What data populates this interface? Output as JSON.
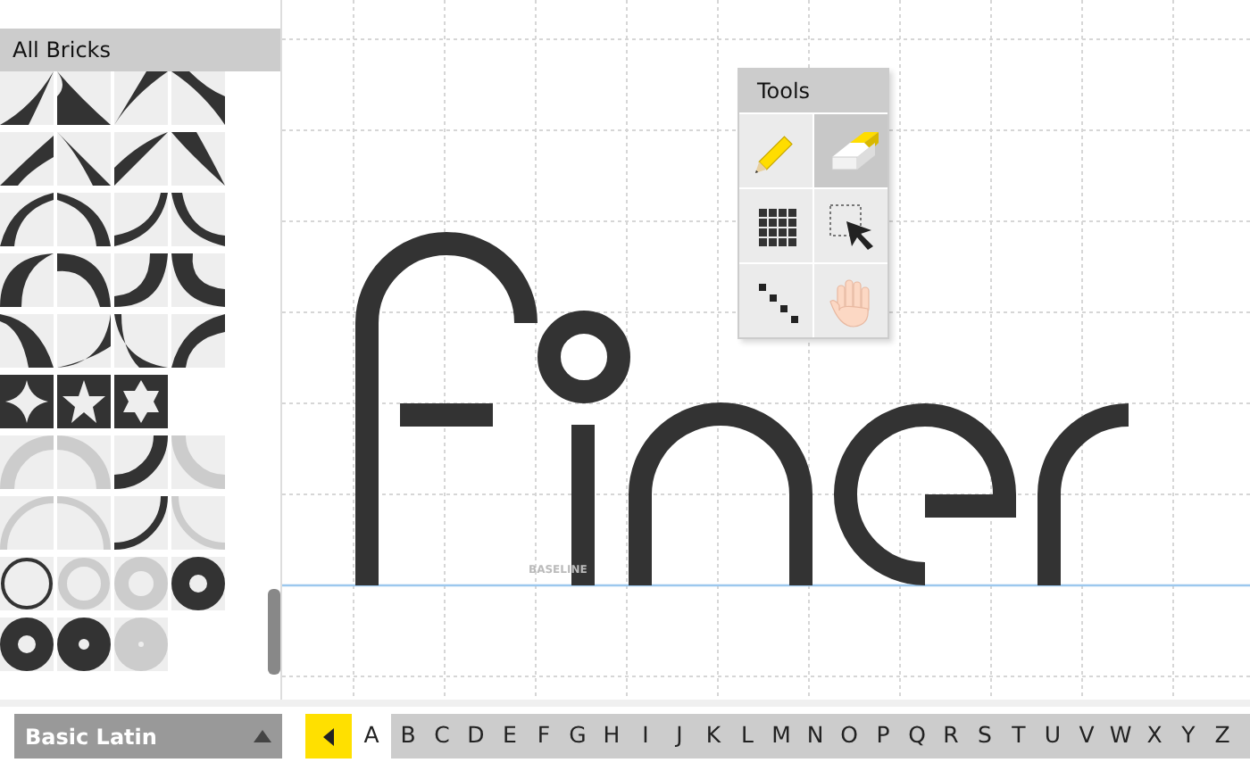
{
  "sidebar": {
    "title": "All Bricks"
  },
  "tools_panel": {
    "title": "Tools",
    "tools": [
      {
        "kind": "pencil",
        "selected": false
      },
      {
        "kind": "eraser",
        "selected": true
      },
      {
        "kind": "grid",
        "selected": false
      },
      {
        "kind": "select",
        "selected": false
      },
      {
        "kind": "line",
        "selected": false
      },
      {
        "kind": "hand",
        "selected": false
      }
    ]
  },
  "canvas": {
    "baseline_label": "BASELINE",
    "glyphs": [
      {
        "kind": "f"
      },
      {
        "kind": "i"
      },
      {
        "kind": "n"
      },
      {
        "kind": "e"
      },
      {
        "kind": "r"
      }
    ]
  },
  "charset": {
    "label": "Basic Latin",
    "characters": [
      {
        "label": "A",
        "selected": true
      },
      {
        "label": "B",
        "selected": false
      },
      {
        "label": "C",
        "selected": false
      },
      {
        "label": "D",
        "selected": false
      },
      {
        "label": "E",
        "selected": false
      },
      {
        "label": "F",
        "selected": false
      },
      {
        "label": "G",
        "selected": false
      },
      {
        "label": "H",
        "selected": false
      },
      {
        "label": "I",
        "selected": false
      },
      {
        "label": "J",
        "selected": false
      },
      {
        "label": "K",
        "selected": false
      },
      {
        "label": "L",
        "selected": false
      },
      {
        "label": "M",
        "selected": false
      },
      {
        "label": "N",
        "selected": false
      },
      {
        "label": "O",
        "selected": false
      },
      {
        "label": "P",
        "selected": false
      },
      {
        "label": "Q",
        "selected": false
      },
      {
        "label": "R",
        "selected": false
      },
      {
        "label": "S",
        "selected": false
      },
      {
        "label": "T",
        "selected": false
      },
      {
        "label": "U",
        "selected": false
      },
      {
        "label": "V",
        "selected": false
      },
      {
        "label": "W",
        "selected": false
      },
      {
        "label": "X",
        "selected": false
      },
      {
        "label": "Y",
        "selected": false
      },
      {
        "label": "Z",
        "selected": false
      }
    ]
  }
}
